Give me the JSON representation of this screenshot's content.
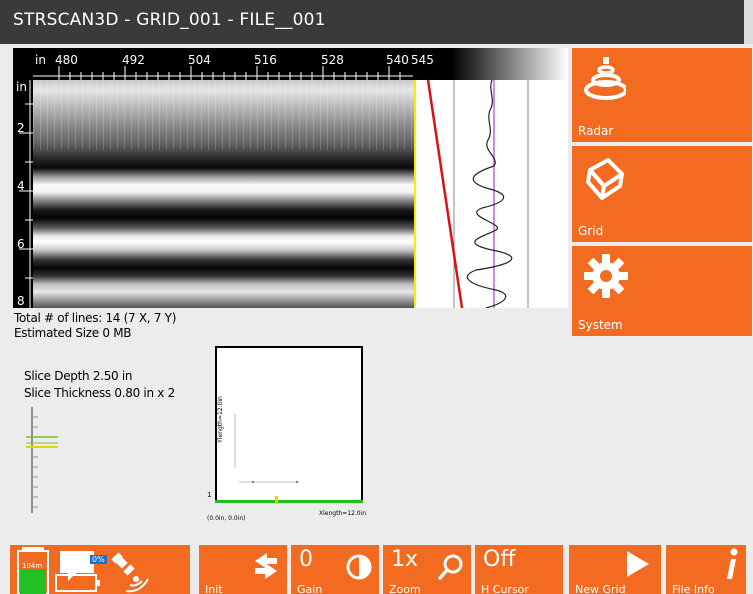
{
  "window": {
    "title": "STRSCAN3D - GRID_001 - FILE__001"
  },
  "scan": {
    "top_ruler": {
      "unit": "in",
      "ticks": [
        "480",
        "492",
        "504",
        "516",
        "528",
        "540",
        "545"
      ]
    },
    "left_ruler": {
      "unit": "in",
      "ticks": [
        "2",
        "4",
        "6",
        "8"
      ]
    }
  },
  "side_menu": [
    {
      "label": "Radar",
      "icon": "radar-icon"
    },
    {
      "label": "Grid",
      "icon": "cube-icon"
    },
    {
      "label": "System",
      "icon": "gear-icon"
    }
  ],
  "info": {
    "total_lines": "Total # of lines: 14 (7 X, 7 Y)",
    "estimated_size": "Estimated Size 0 MB",
    "slice_depth": "Slice Depth 2.50 in",
    "slice_thickness": "Slice Thickness 0.80 in x 2"
  },
  "minigrid": {
    "y_length": "Ylength=12.0in",
    "x_length": "Xlength=12.0in",
    "origin": "(0.0in, 0.0in)",
    "row_marker": "1"
  },
  "toolbar": {
    "status": {
      "memory": "104m",
      "battery": "0%"
    },
    "init": {
      "label": "Init"
    },
    "gain": {
      "value": "0",
      "label": "Gain"
    },
    "zoom": {
      "value": "1x",
      "label": "Zoom"
    },
    "h_cursor": {
      "value": "Off",
      "label": "H Cursor"
    },
    "new_grid": {
      "label": "New Grid"
    },
    "file_info": {
      "label": "File Info"
    }
  },
  "colors": {
    "accent": "#f26b21",
    "titlebar": "#3a3a3a",
    "yellow_cursor": "#f2f200",
    "grid_green": "#1fbf1f",
    "trace_red": "#dd1111",
    "trace_purple": "#bb66dd"
  }
}
